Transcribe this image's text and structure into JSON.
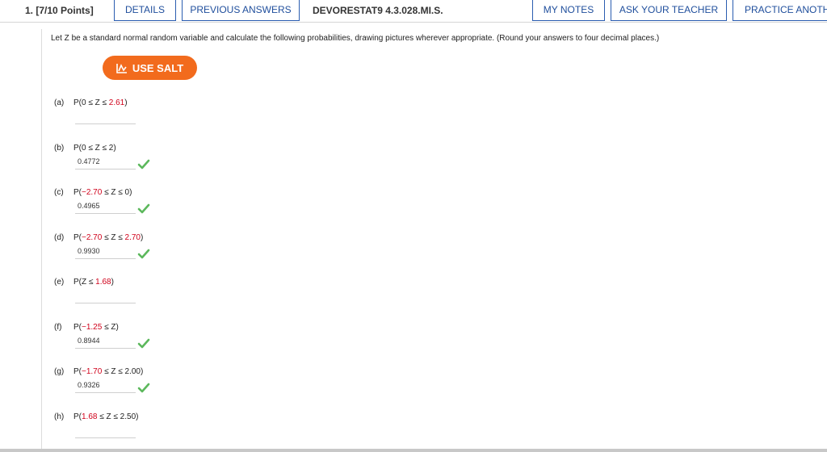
{
  "header": {
    "question_number": "1. [7/10 Points]",
    "details": "DETAILS",
    "previous_answers": "PREVIOUS ANSWERS",
    "assignment_code": "DEVORESTAT9 4.3.028.MI.S.",
    "my_notes": "MY NOTES",
    "ask_teacher": "ASK YOUR TEACHER",
    "practice_another": "PRACTICE ANOTH"
  },
  "prompt": "Let Z be a standard normal random variable and calculate the following probabilities, drawing pictures wherever appropriate. (Round your answers to four decimal places.)",
  "salt_button": "USE SALT",
  "colors": {
    "accent": "#f26b1d",
    "link": "#1f4e9c",
    "red": "#d0021b",
    "check": "#5cb85c"
  },
  "parts": [
    {
      "letter": "(a)",
      "pre": "P(0 ≤ Z ≤ ",
      "red1": "2.61",
      "post": ")",
      "answer": "",
      "correct": false
    },
    {
      "letter": "(b)",
      "pre": "P(0 ≤ Z ≤ 2)",
      "answer": "0.4772",
      "correct": true
    },
    {
      "letter": "(c)",
      "pre": "P(",
      "red1": "−2.70",
      "post": " ≤ Z ≤ 0)",
      "answer": "0.4965",
      "correct": true
    },
    {
      "letter": "(d)",
      "pre": "P(",
      "red1": "−2.70",
      "mid": " ≤ Z ≤ ",
      "red2": "2.70",
      "post": ")",
      "answer": "0.9930",
      "correct": true
    },
    {
      "letter": "(e)",
      "pre": "P(Z ≤ ",
      "red1": "1.68",
      "post": ")",
      "answer": "",
      "correct": false
    },
    {
      "letter": "(f)",
      "pre": "P(",
      "red1": "−1.25",
      "post": " ≤ Z)",
      "answer": "0.8944",
      "correct": true
    },
    {
      "letter": "(g)",
      "pre": "P(",
      "red1": "−1.70",
      "post": " ≤ Z ≤ 2.00)",
      "answer": "0.9326",
      "correct": true
    },
    {
      "letter": "(h)",
      "pre": "P(",
      "red1": "1.68",
      "post": " ≤ Z ≤ 2.50)",
      "answer": "",
      "correct": false
    }
  ]
}
